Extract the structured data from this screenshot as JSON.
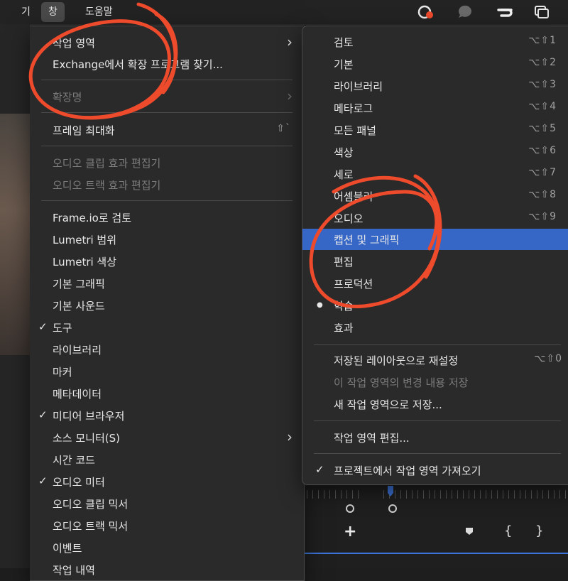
{
  "menubar": {
    "left_partial": "기",
    "window_menu": "창",
    "help_menu": "도움말"
  },
  "left_menu": {
    "items": [
      {
        "label": "작업 영역",
        "arrow": "›"
      },
      {
        "label": "Exchange에서 확장 프로그램 찾기..."
      },
      {
        "label": "확장명",
        "arrow": "›"
      },
      {
        "label": "프레임 최대화",
        "shortcut": "⇧`"
      },
      {
        "label": "오디오 클립 효과 편집기"
      },
      {
        "label": "오디오 트랙 효과 편집기"
      },
      {
        "label": "Frame.io로 검토"
      },
      {
        "label": "Lumetri 범위"
      },
      {
        "label": "Lumetri 색상"
      },
      {
        "label": "기본 그래픽"
      },
      {
        "label": "기본 사운드"
      },
      {
        "label": "도구",
        "check": "✓"
      },
      {
        "label": "라이브러리"
      },
      {
        "label": "마커"
      },
      {
        "label": "메타데이터"
      },
      {
        "label": "미디어 브라우저",
        "check": "✓"
      },
      {
        "label": "소스 모니터(S)",
        "arrow": "›"
      },
      {
        "label": "시간 코드"
      },
      {
        "label": "오디오 미터",
        "check": "✓"
      },
      {
        "label": "오디오 클립 믹서"
      },
      {
        "label": "오디오 트랙 믹서"
      },
      {
        "label": "이벤트"
      },
      {
        "label": "작업 내역"
      }
    ]
  },
  "right_menu": {
    "items": [
      {
        "label": "검토",
        "shortcut": "⌥⇧1"
      },
      {
        "label": "기본",
        "shortcut": "⌥⇧2"
      },
      {
        "label": "라이브러리",
        "shortcut": "⌥⇧3"
      },
      {
        "label": "메타로그",
        "shortcut": "⌥⇧4"
      },
      {
        "label": "모든 패널",
        "shortcut": "⌥⇧5"
      },
      {
        "label": "색상",
        "shortcut": "⌥⇧6"
      },
      {
        "label": "세로",
        "shortcut": "⌥⇧7"
      },
      {
        "label": "어셈블리",
        "shortcut": "⌥⇧8"
      },
      {
        "label": "오디오",
        "shortcut": "⌥⇧9"
      },
      {
        "label": "캡션 및 그래픽"
      },
      {
        "label": "편집"
      },
      {
        "label": "프로덕션"
      },
      {
        "label": "학습",
        "bullet": "●"
      },
      {
        "label": "효과"
      },
      {
        "label": "저장된 레이아웃으로 재설정",
        "shortcut": "⌥⇧0"
      },
      {
        "label": "이 작업 영역의 변경 내용 저장"
      },
      {
        "label": "새 작업 영역으로 저장..."
      },
      {
        "label": "작업 영역 편집..."
      },
      {
        "label": "프로젝트에서 작업 영역 가져오기",
        "check": "✓"
      }
    ]
  },
  "colors": {
    "highlight": "#3767c6",
    "annotation": "#ee4a2c"
  },
  "icons": [
    "creative-cloud-sync-icon",
    "chat-bubble-icon",
    "creative-cloud-icon",
    "window-overlap-icon"
  ]
}
